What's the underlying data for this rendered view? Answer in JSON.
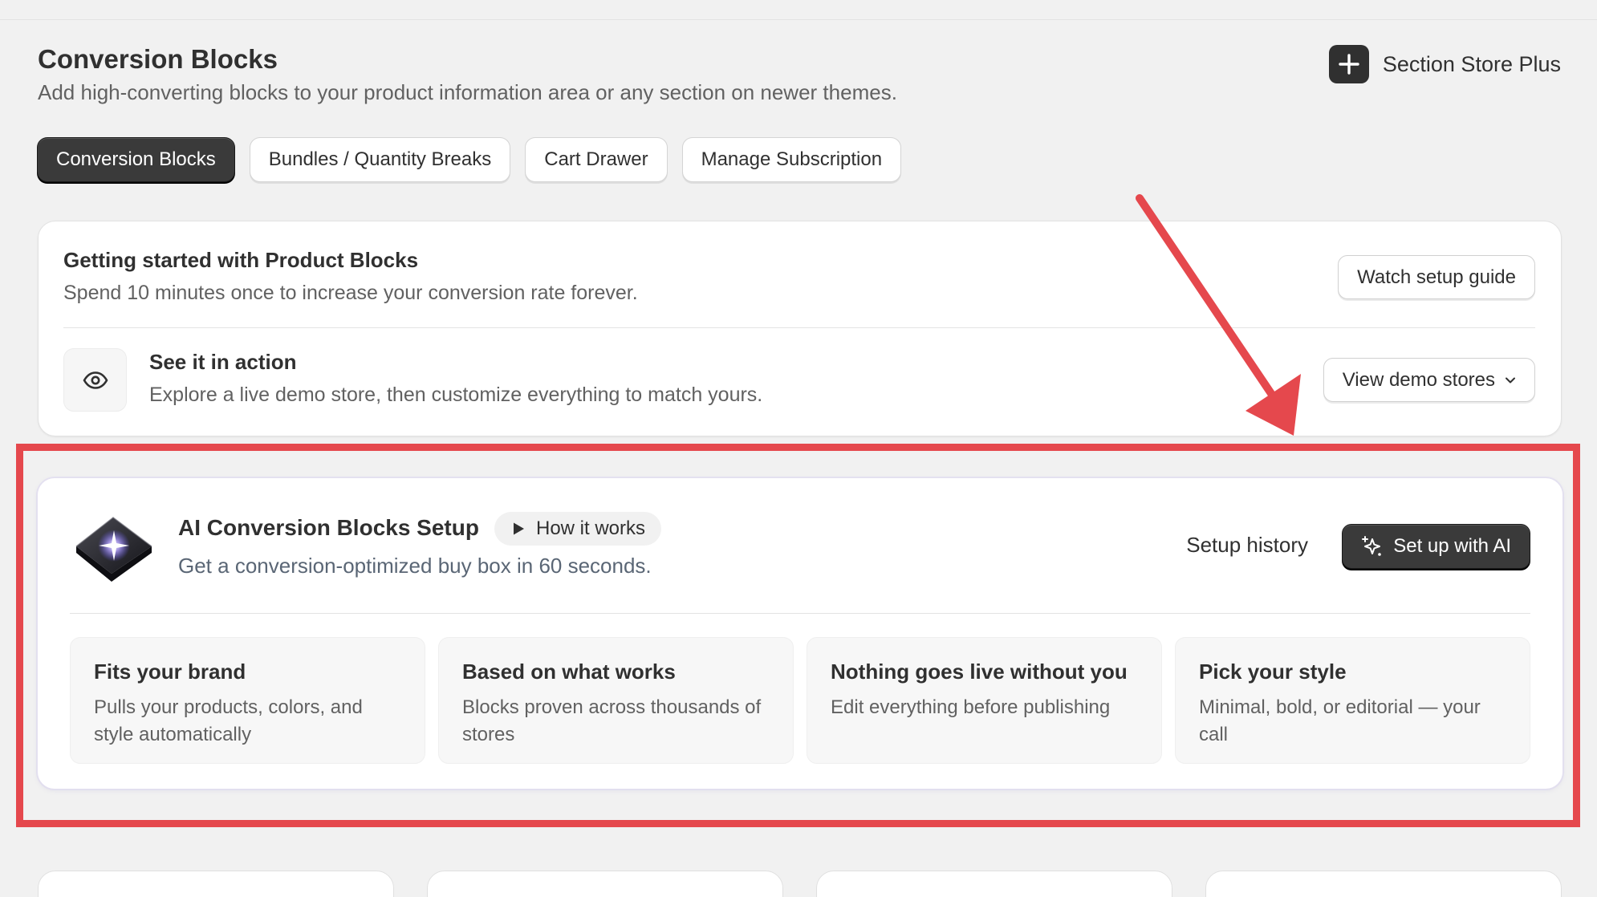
{
  "header": {
    "title": "Conversion Blocks",
    "subtitle": "Add high-converting blocks to your product information area or any section on newer themes.",
    "brand_name": "Section Store Plus",
    "brand_icon": "plus-icon"
  },
  "tabs": [
    {
      "label": "Conversion Blocks",
      "active": true
    },
    {
      "label": "Bundles / Quantity Breaks",
      "active": false
    },
    {
      "label": "Cart Drawer",
      "active": false
    },
    {
      "label": "Manage Subscription",
      "active": false
    }
  ],
  "getting_started": {
    "title": "Getting started with Product Blocks",
    "subtitle": "Spend 10 minutes once to increase your conversion rate forever.",
    "watch_button": "Watch setup guide",
    "action_title": "See it in action",
    "action_subtitle": "Explore a live demo store, then customize everything to match yours.",
    "demo_button": "View demo stores",
    "action_icon": "eye-icon"
  },
  "ai_setup": {
    "title": "AI Conversion Blocks Setup",
    "how_badge": "How it works",
    "subtitle": "Get a conversion-optimized buy box in 60 seconds.",
    "history_link": "Setup history",
    "cta_button": "Set up with AI",
    "features": [
      {
        "title": "Fits your brand",
        "desc": "Pulls your products, colors, and style automatically"
      },
      {
        "title": "Based on what works",
        "desc": "Blocks proven across thousands of stores"
      },
      {
        "title": "Nothing goes live without you",
        "desc": "Edit everything before publishing"
      },
      {
        "title": "Pick your style",
        "desc": "Minimal, bold, or editorial — your call"
      }
    ]
  },
  "colors": {
    "background": "#f1f1f1",
    "primary_button": "#3a3a3a",
    "annotation_red": "#e5484d",
    "subtitle_blue_gray": "#5a6675"
  }
}
